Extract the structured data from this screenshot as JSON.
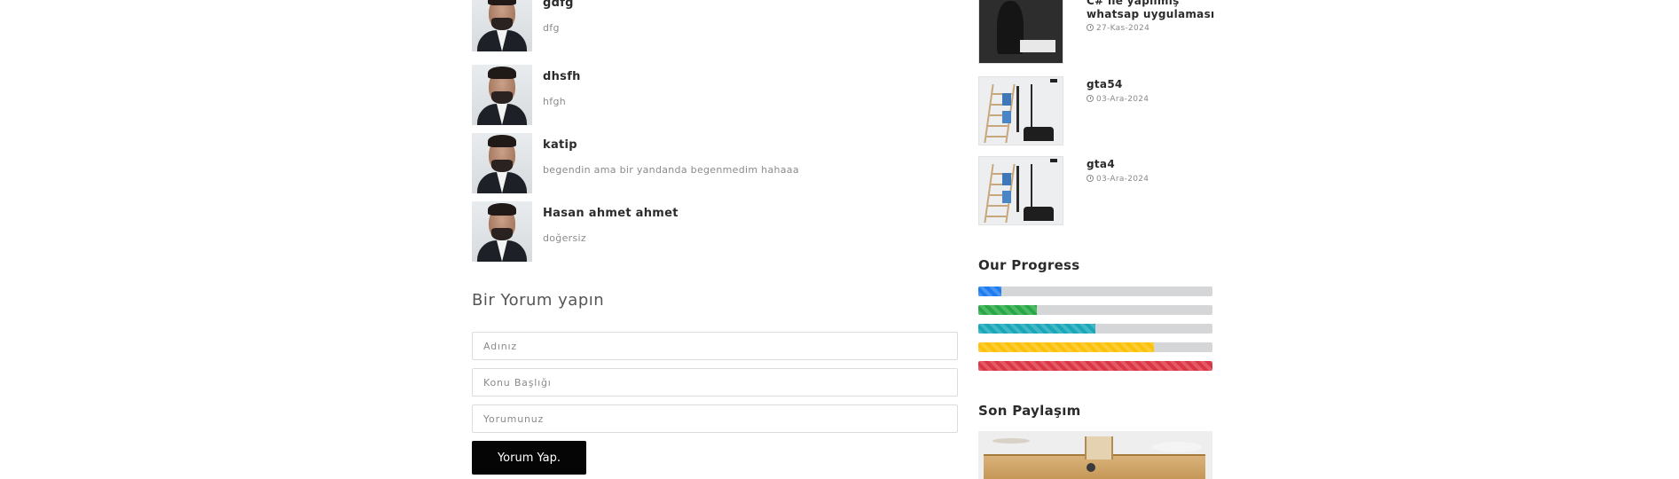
{
  "comments": [
    {
      "name": "gdfg",
      "text": "dfg"
    },
    {
      "name": "dhsfh",
      "text": "hfgh"
    },
    {
      "name": "katip",
      "text": "begendin ama bir yandanda begenmedim hahaaa"
    },
    {
      "name": "Hasan ahmet ahmet",
      "text": "doğersiz"
    }
  ],
  "comment_form": {
    "title": "Bir Yorum yapın",
    "name_placeholder": "Adınız",
    "subject_placeholder": "Konu Başlığı",
    "comment_placeholder": "Yorumunuz",
    "submit_label": "Yorum Yap."
  },
  "sidebar": {
    "recent_posts": [
      {
        "title": "C# ile yapılmış whatsap uygulaması",
        "date": "27-Kas-2024"
      },
      {
        "title": "gta54",
        "date": "03-Ara-2024"
      },
      {
        "title": "gta4",
        "date": "03-Ara-2024"
      }
    ],
    "progress": {
      "title": "Our Progress",
      "bars": [
        {
          "percent": 10,
          "color": "#1f7cf0"
        },
        {
          "percent": 25,
          "color": "#27a844"
        },
        {
          "percent": 50,
          "color": "#19a7b9"
        },
        {
          "percent": 75,
          "color": "#fec109"
        },
        {
          "percent": 100,
          "color": "#dc3645"
        }
      ]
    },
    "last_share_title": "Son Paylaşım"
  },
  "colors": {
    "button_bg": "#050505",
    "heading": "#2b2b2b",
    "muted_text": "#8a8a8a"
  },
  "icons": {
    "date": "clock-icon"
  }
}
